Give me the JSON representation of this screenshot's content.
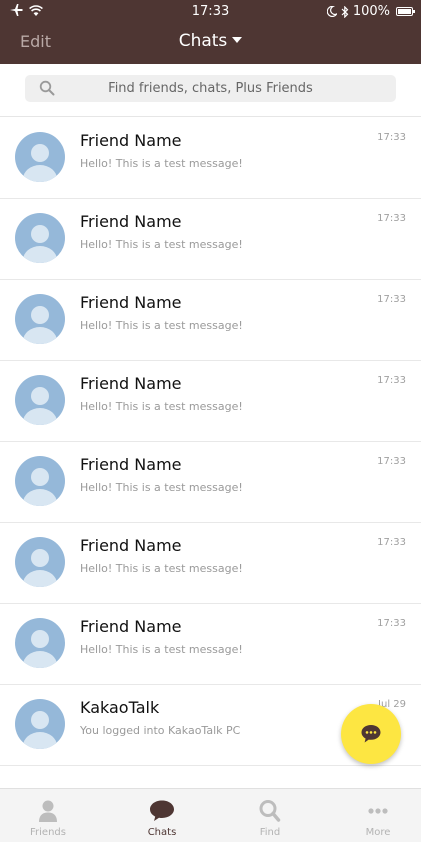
{
  "status_bar": {
    "time": "17:33",
    "battery": "100%",
    "icons": [
      "airplane-icon",
      "wifi-icon",
      "moon-icon",
      "bluetooth-icon",
      "battery-icon"
    ]
  },
  "header": {
    "edit_label": "Edit",
    "title": "Chats"
  },
  "search": {
    "placeholder": "Find friends, chats, Plus Friends"
  },
  "chats": [
    {
      "name": "Friend Name",
      "message": "Hello! This is a test message!",
      "time": "17:33"
    },
    {
      "name": "Friend Name",
      "message": "Hello! This is a test message!",
      "time": "17:33"
    },
    {
      "name": "Friend Name",
      "message": "Hello! This is a test message!",
      "time": "17:33"
    },
    {
      "name": "Friend Name",
      "message": "Hello! This is a test message!",
      "time": "17:33"
    },
    {
      "name": "Friend Name",
      "message": "Hello! This is a test message!",
      "time": "17:33"
    },
    {
      "name": "Friend Name",
      "message": "Hello! This is a test message!",
      "time": "17:33"
    },
    {
      "name": "Friend Name",
      "message": "Hello! This is a test message!",
      "time": "17:33"
    },
    {
      "name": "KakaoTalk",
      "message": "You logged into KakaoTalk PC",
      "time": "Jul 29"
    }
  ],
  "tabs": [
    {
      "label": "Friends",
      "icon": "person-icon",
      "active": false
    },
    {
      "label": "Chats",
      "icon": "chat-bubble-icon",
      "active": true
    },
    {
      "label": "Find",
      "icon": "search-icon",
      "active": false
    },
    {
      "label": "More",
      "icon": "more-dots-icon",
      "active": false
    }
  ],
  "colors": {
    "header_bg": "#4e3633",
    "fab": "#fde642",
    "avatar": "#95b8d9"
  }
}
